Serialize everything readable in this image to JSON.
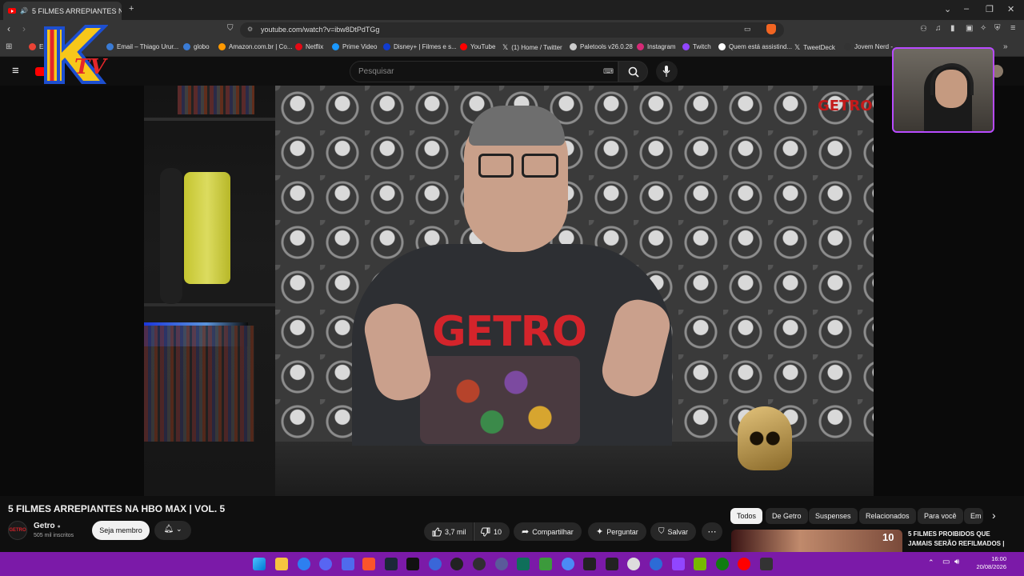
{
  "browser": {
    "tab_title": "5 FILMES ARREPIANTES NA H",
    "url": "youtube.com/watch?v=ibw8DtPdTGg",
    "bookmarks": [
      {
        "label": "En",
        "color": "#ea4335"
      },
      {
        "label": "Email – Thiago Urur...",
        "color": "#3a7bd5"
      },
      {
        "label": "globo",
        "color": "#3a7bd5"
      },
      {
        "label": "Amazon.com.br | Co...",
        "color": "#ff9900"
      },
      {
        "label": "Netflix",
        "color": "#e50914"
      },
      {
        "label": "Prime Video",
        "color": "#1a98ff"
      },
      {
        "label": "Disney+ | Filmes e s...",
        "color": "#113ccf"
      },
      {
        "label": "YouTube",
        "color": "#ff0000"
      },
      {
        "label": "(1) Home / Twitter",
        "color": "#ffffff"
      },
      {
        "label": "Paletools v26.0.28",
        "color": "#cccccc"
      },
      {
        "label": "Instagram",
        "color": "#d62976"
      },
      {
        "label": "Twitch",
        "color": "#9146ff"
      },
      {
        "label": "Quem está assistind...",
        "color": "#ffffff"
      },
      {
        "label": "TweetDeck",
        "color": "#ffffff"
      },
      {
        "label": "Jovem Nerd -",
        "color": "#333333"
      }
    ]
  },
  "youtube": {
    "search_placeholder": "Pesquisar",
    "video_title": "5 FILMES ARREPIANTES NA HBO MAX | VOL. 5",
    "channel": {
      "name": "Getro",
      "subscribers": "505 mil inscritos",
      "avatar_text": "GETRO"
    },
    "join_label": "Seja membro",
    "likes": "3,7 mil",
    "dislikes": "10",
    "share_label": "Compartilhar",
    "ask_label": "Perguntar",
    "save_label": "Salvar",
    "chips": [
      "Todos",
      "De Getro",
      "Suspenses",
      "Relacionados",
      "Para você",
      "Em"
    ],
    "recommendation": {
      "number": "10",
      "title": "5 FILMES PROIBIDOS QUE JAMAIS SERÃO REFILMADOS |"
    },
    "video_shirt_text": "GETRO",
    "video_watermark": "GETRO"
  },
  "overlay": {
    "logo_text": "TV"
  },
  "system": {
    "time": "16:00",
    "date": "20/08/2026"
  },
  "colors": {
    "accent": "#ff0000",
    "taskbar": "#7b1aa8",
    "webcam_border": "#b84bff"
  }
}
